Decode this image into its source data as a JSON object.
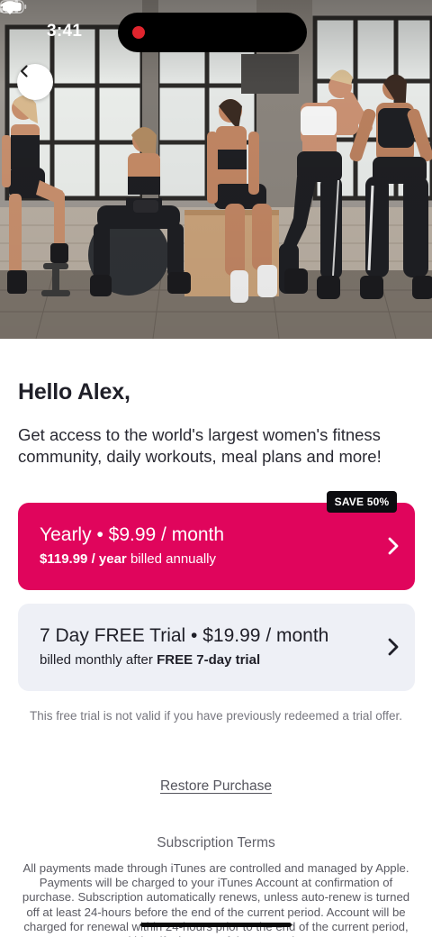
{
  "status_bar": {
    "time": "3:41"
  },
  "icons": {
    "back": "chevron-left-icon",
    "recording": "recording-dot-icon",
    "signal": "cellular-signal-icon",
    "wifi": "wifi-icon",
    "battery": "battery-icon",
    "plan_arrow": "chevron-right-icon"
  },
  "greeting": "Hello Alex,",
  "description": "Get access to the world's largest women's fitness community, daily workouts, meal plans and more!",
  "plans": [
    {
      "title_bold": "Yearly",
      "sep": " • ",
      "price": "$9.99",
      "per": " / month",
      "sub_price": "$119.99",
      "sub_unit": " / year",
      "sub_rest": " billed annually",
      "badge": "SAVE 50%"
    },
    {
      "title_bold": "7 Day FREE Trial",
      "sep": " • ",
      "price": "$19.99",
      "per": " / month",
      "sub_prefix": "billed monthly after ",
      "sub_bold": "FREE 7-day trial"
    }
  ],
  "trial_note": "This free trial is not valid if you have previously redeemed a trial offer.",
  "restore_label": "Restore Purchase",
  "terms_title": "Subscription Terms",
  "terms_body": "All payments made through iTunes are controlled and managed by Apple. Payments will be charged to your iTunes Account at confirmation of purchase. Subscription automatically renews, unless auto-renew is turned off at least 24-hours before the end of the current period. Account will be charged for renewal within 24-hours prior to the end of the current period, and identify the cost of the renewal. You",
  "colors": {
    "accent": "#e0055c",
    "trial_card": "#eef0f6",
    "badge": "#0c0c10"
  }
}
